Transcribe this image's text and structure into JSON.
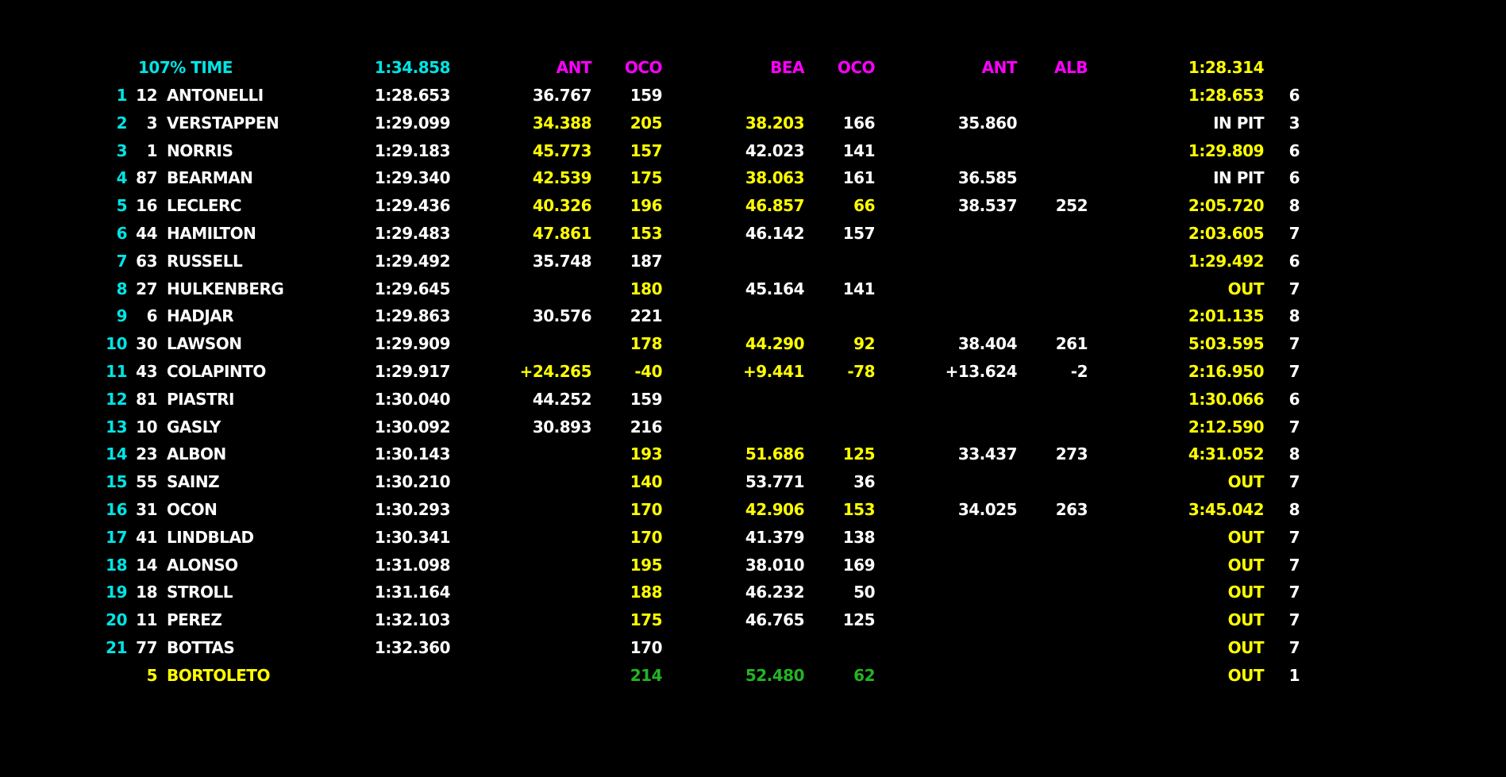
{
  "colors": {
    "background": "#000000",
    "white": "#ffffff",
    "yellow": "#ffff00",
    "green": "#22b522",
    "cyan": "#00e5e5",
    "magenta": "#ff00ff"
  },
  "header": {
    "label": "107% TIME",
    "time": "1:34.858",
    "s1_driver": "ANT",
    "s1_rel": "OCO",
    "s2_driver": "BEA",
    "s2_rel": "OCO",
    "s3_driver": "ANT",
    "s3_rel": "ALB",
    "best": "1:28.314"
  },
  "rows": [
    {
      "pos": "1",
      "num": "12",
      "name": "ANTONELLI",
      "time": "1:28.653",
      "s1": "36.767",
      "s1c": "white",
      "v1": "159",
      "v1c": "white",
      "s2": "",
      "s2c": "white",
      "v2": "",
      "v2c": "white",
      "s3": "",
      "s3c": "white",
      "v3": "",
      "v3c": "white",
      "last": "1:28.653",
      "lastc": "yellow",
      "laps": "6",
      "namec": "white",
      "posc": "cyan"
    },
    {
      "pos": "2",
      "num": "3",
      "name": "VERSTAPPEN",
      "time": "1:29.099",
      "s1": "34.388",
      "s1c": "yellow",
      "v1": "205",
      "v1c": "yellow",
      "s2": "38.203",
      "s2c": "yellow",
      "v2": "166",
      "v2c": "white",
      "s3": "35.860",
      "s3c": "white",
      "v3": "",
      "v3c": "white",
      "last": "IN PIT",
      "lastc": "white",
      "laps": "3",
      "namec": "white",
      "posc": "cyan"
    },
    {
      "pos": "3",
      "num": "1",
      "name": "NORRIS",
      "time": "1:29.183",
      "s1": "45.773",
      "s1c": "yellow",
      "v1": "157",
      "v1c": "yellow",
      "s2": "42.023",
      "s2c": "white",
      "v2": "141",
      "v2c": "white",
      "s3": "",
      "s3c": "white",
      "v3": "",
      "v3c": "white",
      "last": "1:29.809",
      "lastc": "yellow",
      "laps": "6",
      "namec": "white",
      "posc": "cyan"
    },
    {
      "pos": "4",
      "num": "87",
      "name": "BEARMAN",
      "time": "1:29.340",
      "s1": "42.539",
      "s1c": "yellow",
      "v1": "175",
      "v1c": "yellow",
      "s2": "38.063",
      "s2c": "yellow",
      "v2": "161",
      "v2c": "white",
      "s3": "36.585",
      "s3c": "white",
      "v3": "",
      "v3c": "white",
      "last": "IN PIT",
      "lastc": "white",
      "laps": "6",
      "namec": "white",
      "posc": "cyan"
    },
    {
      "pos": "5",
      "num": "16",
      "name": "LECLERC",
      "time": "1:29.436",
      "s1": "40.326",
      "s1c": "yellow",
      "v1": "196",
      "v1c": "yellow",
      "s2": "46.857",
      "s2c": "yellow",
      "v2": "66",
      "v2c": "yellow",
      "s3": "38.537",
      "s3c": "white",
      "v3": "252",
      "v3c": "white",
      "last": "2:05.720",
      "lastc": "yellow",
      "laps": "8",
      "namec": "white",
      "posc": "cyan"
    },
    {
      "pos": "6",
      "num": "44",
      "name": "HAMILTON",
      "time": "1:29.483",
      "s1": "47.861",
      "s1c": "yellow",
      "v1": "153",
      "v1c": "yellow",
      "s2": "46.142",
      "s2c": "white",
      "v2": "157",
      "v2c": "white",
      "s3": "",
      "s3c": "white",
      "v3": "",
      "v3c": "white",
      "last": "2:03.605",
      "lastc": "yellow",
      "laps": "7",
      "namec": "white",
      "posc": "cyan"
    },
    {
      "pos": "7",
      "num": "63",
      "name": "RUSSELL",
      "time": "1:29.492",
      "s1": "35.748",
      "s1c": "white",
      "v1": "187",
      "v1c": "white",
      "s2": "",
      "s2c": "white",
      "v2": "",
      "v2c": "white",
      "s3": "",
      "s3c": "white",
      "v3": "",
      "v3c": "white",
      "last": "1:29.492",
      "lastc": "yellow",
      "laps": "6",
      "namec": "white",
      "posc": "cyan"
    },
    {
      "pos": "8",
      "num": "27",
      "name": "HULKENBERG",
      "time": "1:29.645",
      "s1": "",
      "s1c": "white",
      "v1": "180",
      "v1c": "yellow",
      "s2": "45.164",
      "s2c": "white",
      "v2": "141",
      "v2c": "white",
      "s3": "",
      "s3c": "white",
      "v3": "",
      "v3c": "white",
      "last": "OUT",
      "lastc": "yellow",
      "laps": "7",
      "namec": "white",
      "posc": "cyan"
    },
    {
      "pos": "9",
      "num": "6",
      "name": "HADJAR",
      "time": "1:29.863",
      "s1": "30.576",
      "s1c": "white",
      "v1": "221",
      "v1c": "white",
      "s2": "",
      "s2c": "white",
      "v2": "",
      "v2c": "white",
      "s3": "",
      "s3c": "white",
      "v3": "",
      "v3c": "white",
      "last": "2:01.135",
      "lastc": "yellow",
      "laps": "8",
      "namec": "white",
      "posc": "cyan"
    },
    {
      "pos": "10",
      "num": "30",
      "name": "LAWSON",
      "time": "1:29.909",
      "s1": "",
      "s1c": "white",
      "v1": "178",
      "v1c": "yellow",
      "s2": "44.290",
      "s2c": "yellow",
      "v2": "92",
      "v2c": "yellow",
      "s3": "38.404",
      "s3c": "white",
      "v3": "261",
      "v3c": "white",
      "last": "5:03.595",
      "lastc": "yellow",
      "laps": "7",
      "namec": "white",
      "posc": "cyan"
    },
    {
      "pos": "11",
      "num": "43",
      "name": "COLAPINTO",
      "time": "1:29.917",
      "s1": "+24.265",
      "s1c": "yellow",
      "v1": "-40",
      "v1c": "yellow",
      "s2": "+9.441",
      "s2c": "yellow",
      "v2": "-78",
      "v2c": "yellow",
      "s3": "+13.624",
      "s3c": "white",
      "v3": "-2",
      "v3c": "white",
      "last": "2:16.950",
      "lastc": "yellow",
      "laps": "7",
      "namec": "white",
      "posc": "cyan"
    },
    {
      "pos": "12",
      "num": "81",
      "name": "PIASTRI",
      "time": "1:30.040",
      "s1": "44.252",
      "s1c": "white",
      "v1": "159",
      "v1c": "white",
      "s2": "",
      "s2c": "white",
      "v2": "",
      "v2c": "white",
      "s3": "",
      "s3c": "white",
      "v3": "",
      "v3c": "white",
      "last": "1:30.066",
      "lastc": "yellow",
      "laps": "6",
      "namec": "white",
      "posc": "cyan"
    },
    {
      "pos": "13",
      "num": "10",
      "name": "GASLY",
      "time": "1:30.092",
      "s1": "30.893",
      "s1c": "white",
      "v1": "216",
      "v1c": "white",
      "s2": "",
      "s2c": "white",
      "v2": "",
      "v2c": "white",
      "s3": "",
      "s3c": "white",
      "v3": "",
      "v3c": "white",
      "last": "2:12.590",
      "lastc": "yellow",
      "laps": "7",
      "namec": "white",
      "posc": "cyan"
    },
    {
      "pos": "14",
      "num": "23",
      "name": "ALBON",
      "time": "1:30.143",
      "s1": "",
      "s1c": "white",
      "v1": "193",
      "v1c": "yellow",
      "s2": "51.686",
      "s2c": "yellow",
      "v2": "125",
      "v2c": "yellow",
      "s3": "33.437",
      "s3c": "white",
      "v3": "273",
      "v3c": "white",
      "last": "4:31.052",
      "lastc": "yellow",
      "laps": "8",
      "namec": "white",
      "posc": "cyan"
    },
    {
      "pos": "15",
      "num": "55",
      "name": "SAINZ",
      "time": "1:30.210",
      "s1": "",
      "s1c": "white",
      "v1": "140",
      "v1c": "yellow",
      "s2": "53.771",
      "s2c": "white",
      "v2": "36",
      "v2c": "white",
      "s3": "",
      "s3c": "white",
      "v3": "",
      "v3c": "white",
      "last": "OUT",
      "lastc": "yellow",
      "laps": "7",
      "namec": "white",
      "posc": "cyan"
    },
    {
      "pos": "16",
      "num": "31",
      "name": "OCON",
      "time": "1:30.293",
      "s1": "",
      "s1c": "white",
      "v1": "170",
      "v1c": "yellow",
      "s2": "42.906",
      "s2c": "yellow",
      "v2": "153",
      "v2c": "yellow",
      "s3": "34.025",
      "s3c": "white",
      "v3": "263",
      "v3c": "white",
      "last": "3:45.042",
      "lastc": "yellow",
      "laps": "8",
      "namec": "white",
      "posc": "cyan"
    },
    {
      "pos": "17",
      "num": "41",
      "name": "LINDBLAD",
      "time": "1:30.341",
      "s1": "",
      "s1c": "white",
      "v1": "170",
      "v1c": "yellow",
      "s2": "41.379",
      "s2c": "white",
      "v2": "138",
      "v2c": "white",
      "s3": "",
      "s3c": "white",
      "v3": "",
      "v3c": "white",
      "last": "OUT",
      "lastc": "yellow",
      "laps": "7",
      "namec": "white",
      "posc": "cyan"
    },
    {
      "pos": "18",
      "num": "14",
      "name": "ALONSO",
      "time": "1:31.098",
      "s1": "",
      "s1c": "white",
      "v1": "195",
      "v1c": "yellow",
      "s2": "38.010",
      "s2c": "white",
      "v2": "169",
      "v2c": "white",
      "s3": "",
      "s3c": "white",
      "v3": "",
      "v3c": "white",
      "last": "OUT",
      "lastc": "yellow",
      "laps": "7",
      "namec": "white",
      "posc": "cyan"
    },
    {
      "pos": "19",
      "num": "18",
      "name": "STROLL",
      "time": "1:31.164",
      "s1": "",
      "s1c": "white",
      "v1": "188",
      "v1c": "yellow",
      "s2": "46.232",
      "s2c": "white",
      "v2": "50",
      "v2c": "white",
      "s3": "",
      "s3c": "white",
      "v3": "",
      "v3c": "white",
      "last": "OUT",
      "lastc": "yellow",
      "laps": "7",
      "namec": "white",
      "posc": "cyan"
    },
    {
      "pos": "20",
      "num": "11",
      "name": "PEREZ",
      "time": "1:32.103",
      "s1": "",
      "s1c": "white",
      "v1": "175",
      "v1c": "yellow",
      "s2": "46.765",
      "s2c": "white",
      "v2": "125",
      "v2c": "white",
      "s3": "",
      "s3c": "white",
      "v3": "",
      "v3c": "white",
      "last": "OUT",
      "lastc": "yellow",
      "laps": "7",
      "namec": "white",
      "posc": "cyan"
    },
    {
      "pos": "21",
      "num": "77",
      "name": "BOTTAS",
      "time": "1:32.360",
      "s1": "",
      "s1c": "white",
      "v1": "170",
      "v1c": "white",
      "s2": "",
      "s2c": "white",
      "v2": "",
      "v2c": "white",
      "s3": "",
      "s3c": "white",
      "v3": "",
      "v3c": "white",
      "last": "OUT",
      "lastc": "yellow",
      "laps": "7",
      "namec": "white",
      "posc": "cyan"
    },
    {
      "pos": "",
      "num": "5",
      "name": "BORTOLETO",
      "time": "",
      "s1": "",
      "s1c": "white",
      "v1": "214",
      "v1c": "green",
      "s2": "52.480",
      "s2c": "green",
      "v2": "62",
      "v2c": "green",
      "s3": "",
      "s3c": "white",
      "v3": "",
      "v3c": "white",
      "last": "OUT",
      "lastc": "yellow",
      "laps": "1",
      "namec": "yellow",
      "posc": "cyan",
      "numc": "yellow"
    }
  ]
}
